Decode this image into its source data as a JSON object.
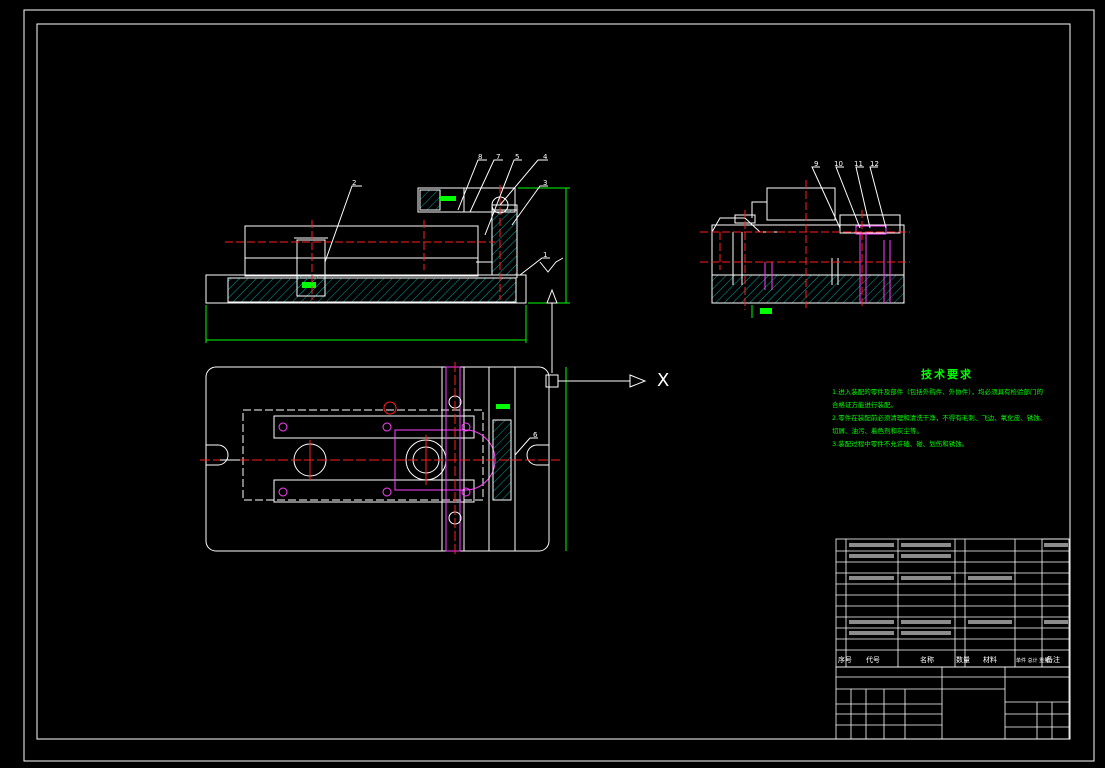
{
  "drawing": {
    "technical_requirements": {
      "title": "技术要求",
      "lines": [
        "1.进入装配的零件及部件（包括外购件、外协件），均必须具有检验部门的",
        "合格证方能进行装配。",
        "2.零件在装配前必须清理和清洗干净，不得有毛刺、飞边、氧化皮、锈蚀、",
        "切屑、油污、着色剂和灰尘等。",
        "3.装配过程中零件不允许磕、碰、划伤和锈蚀。"
      ]
    },
    "axis_label": "X",
    "balloon_numbers": [
      "1",
      "2",
      "3",
      "4",
      "5",
      "6",
      "7",
      "8",
      "9",
      "10",
      "11",
      "12"
    ],
    "title_block": {
      "headers": [
        "序号",
        "代号",
        "名称",
        "数量",
        "材料",
        "单件 总计 重量",
        "备注"
      ]
    }
  },
  "colors": {
    "background": "#000000",
    "frame": "#ffffff",
    "outline": "#ffffff",
    "center_line": "#ff2020",
    "dimension": "#00ff00",
    "hatch": "#00a0a0",
    "part": "#ff40ff",
    "leader": "#ffffff"
  }
}
